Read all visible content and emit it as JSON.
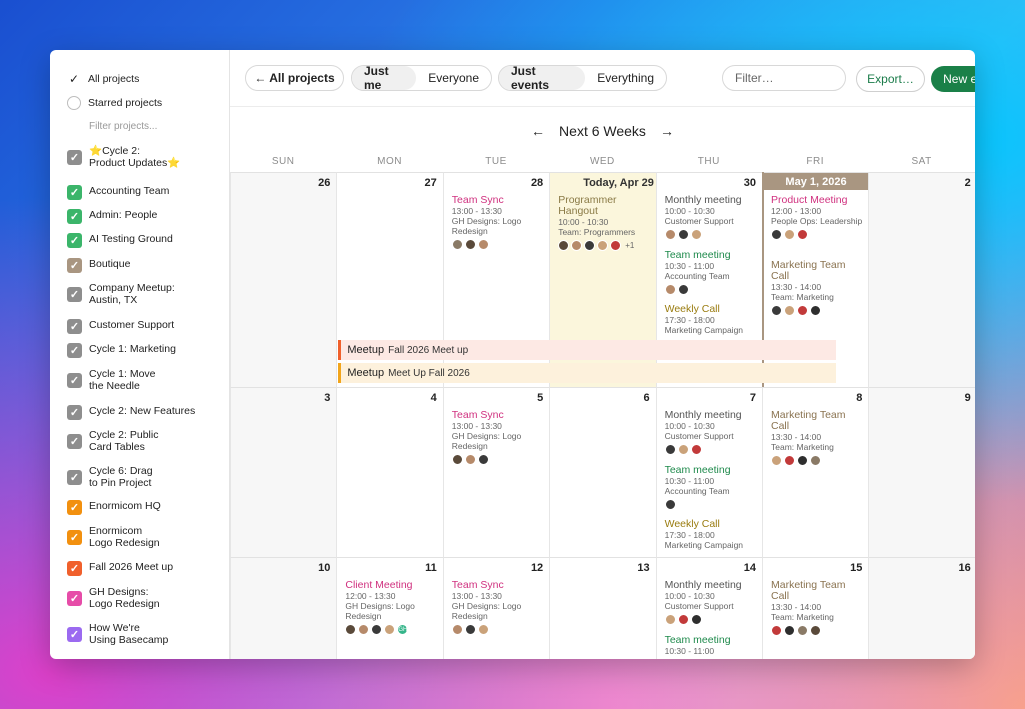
{
  "sidebar": {
    "all_projects": "All projects",
    "starred_projects": "Starred projects",
    "filter_placeholder": "Filter projects...",
    "projects": [
      {
        "line1": "⭐Cycle 2:",
        "line2": "Product Updates⭐",
        "color": "#8e8e8e"
      },
      {
        "line1": "Accounting Team",
        "line2": "",
        "color": "#3bb56a"
      },
      {
        "line1": "Admin: People",
        "line2": "",
        "color": "#3bb56a"
      },
      {
        "line1": "AI Testing Ground",
        "line2": "",
        "color": "#3bb56a"
      },
      {
        "line1": "Boutique",
        "line2": "",
        "color": "#a99681"
      },
      {
        "line1": "Company Meetup:",
        "line2": "Austin, TX",
        "color": "#8e8e8e"
      },
      {
        "line1": "Customer Support",
        "line2": "",
        "color": "#8e8e8e"
      },
      {
        "line1": "Cycle 1: Marketing",
        "line2": "",
        "color": "#8e8e8e"
      },
      {
        "line1": "Cycle 1: Move",
        "line2": "the Needle",
        "color": "#8e8e8e"
      },
      {
        "line1": "Cycle 2: New Features",
        "line2": "",
        "color": "#8e8e8e"
      },
      {
        "line1": "Cycle 2: Public",
        "line2": "Card Tables",
        "color": "#8e8e8e"
      },
      {
        "line1": "Cycle 6: Drag",
        "line2": "to Pin Project",
        "color": "#8e8e8e"
      },
      {
        "line1": "Enormicom HQ",
        "line2": "",
        "color": "#f2900f"
      },
      {
        "line1": "Enormicom",
        "line2": "Logo Redesign",
        "color": "#f2900f"
      },
      {
        "line1": "Fall 2026 Meet up",
        "line2": "",
        "color": "#f0602c"
      },
      {
        "line1": "GH Designs:",
        "line2": "Logo Redesign",
        "color": "#e64ca8"
      },
      {
        "line1": "How We're",
        "line2": "Using Basecamp",
        "color": "#9b6af0"
      }
    ]
  },
  "toolbar": {
    "all_projects": "← All projects",
    "just_me": "Just me",
    "everyone": "Everyone",
    "just_events": "Just events",
    "everything": "Everything",
    "filter_placeholder": "Filter…",
    "export": "Export…",
    "new_event": "New event"
  },
  "nav": {
    "prev": "←",
    "title": "Next 6 Weeks",
    "next": "→"
  },
  "days_of_week": [
    "SUN",
    "MON",
    "TUE",
    "WED",
    "THU",
    "FRI",
    "SAT"
  ],
  "weeks": [
    {
      "days": [
        "26",
        "27",
        "28",
        "Today, Apr 29",
        "30",
        "May 1, 2026",
        "2"
      ]
    },
    {
      "days": [
        "3",
        "4",
        "5",
        "6",
        "7",
        "8",
        "9"
      ]
    },
    {
      "days": [
        "10",
        "11",
        "12",
        "13",
        "14",
        "15",
        "16"
      ]
    }
  ],
  "events": {
    "w1_tue": {
      "title": "Team Sync",
      "time": "13:00 - 13:30",
      "proj": "GH Designs: Logo Redesign",
      "color": "#d0317f"
    },
    "w1_wed": {
      "title": "Programmer Hangout",
      "time": "10:00 - 10:30",
      "proj": "Team: Programmers",
      "color": "#8a7a46",
      "more": "+1"
    },
    "w1_thu_1": {
      "title": "Monthly meeting",
      "time": "10:00 - 10:30",
      "proj": "Customer Support",
      "color": "#555555"
    },
    "w1_thu_2": {
      "title": "Team meeting",
      "time": "10:30 - 11:00",
      "proj": "Accounting Team",
      "color": "#1f8a4c"
    },
    "w1_thu_3": {
      "title": "Weekly Call",
      "time": "17:30 - 18:00",
      "proj": "Marketing Campaign",
      "color": "#9a7c10"
    },
    "w1_fri_1": {
      "title": "Product Meeting",
      "time": "12:00 - 13:00",
      "proj": "People Ops: Leadership",
      "color": "#d0317f"
    },
    "w1_fri_2": {
      "title": "Marketing Team Call",
      "time": "13:30 - 14:00",
      "proj": "Team: Marketing",
      "color": "#8a7350"
    },
    "w2_tue": {
      "title": "Team Sync",
      "time": "13:00 - 13:30",
      "proj": "GH Designs: Logo Redesign",
      "color": "#d0317f"
    },
    "w2_thu_1": {
      "title": "Monthly meeting",
      "time": "10:00 - 10:30",
      "proj": "Customer Support",
      "color": "#555555"
    },
    "w2_thu_2": {
      "title": "Team meeting",
      "time": "10:30 - 11:00",
      "proj": "Accounting Team",
      "color": "#1f8a4c"
    },
    "w2_thu_3": {
      "title": "Weekly Call",
      "time": "17:30 - 18:00",
      "proj": "Marketing Campaign",
      "color": "#9a7c10"
    },
    "w2_fri": {
      "title": "Marketing Team Call",
      "time": "13:30 - 14:00",
      "proj": "Team: Marketing",
      "color": "#8a7350"
    },
    "w3_mon": {
      "title": "Client Meeting",
      "time": "12:00 - 13:30",
      "proj": "GH Designs: Logo Redesign",
      "color": "#d0317f"
    },
    "w3_tue": {
      "title": "Team Sync",
      "time": "13:00 - 13:30",
      "proj": "GH Designs: Logo Redesign",
      "color": "#d0317f"
    },
    "w3_thu_1": {
      "title": "Monthly meeting",
      "time": "10:00 - 10:30",
      "proj": "Customer Support",
      "color": "#555555"
    },
    "w3_thu_2": {
      "title": "Team meeting",
      "time": "10:30 - 11:00",
      "proj": "",
      "color": "#1f8a4c"
    },
    "w3_fri": {
      "title": "Marketing Team Call",
      "time": "13:30 - 14:00",
      "proj": "Team: Marketing",
      "color": "#8a7350"
    }
  },
  "multiday": [
    {
      "label": "Meetup",
      "detail": "Fall 2026 Meet up",
      "bg": "#fde9e4",
      "accent": "#f0602c"
    },
    {
      "label": "Meetup",
      "detail": "Meet Up Fall 2026",
      "bg": "#fdf1dc",
      "accent": "#f2a51b"
    }
  ],
  "avatar_badge": "GH"
}
